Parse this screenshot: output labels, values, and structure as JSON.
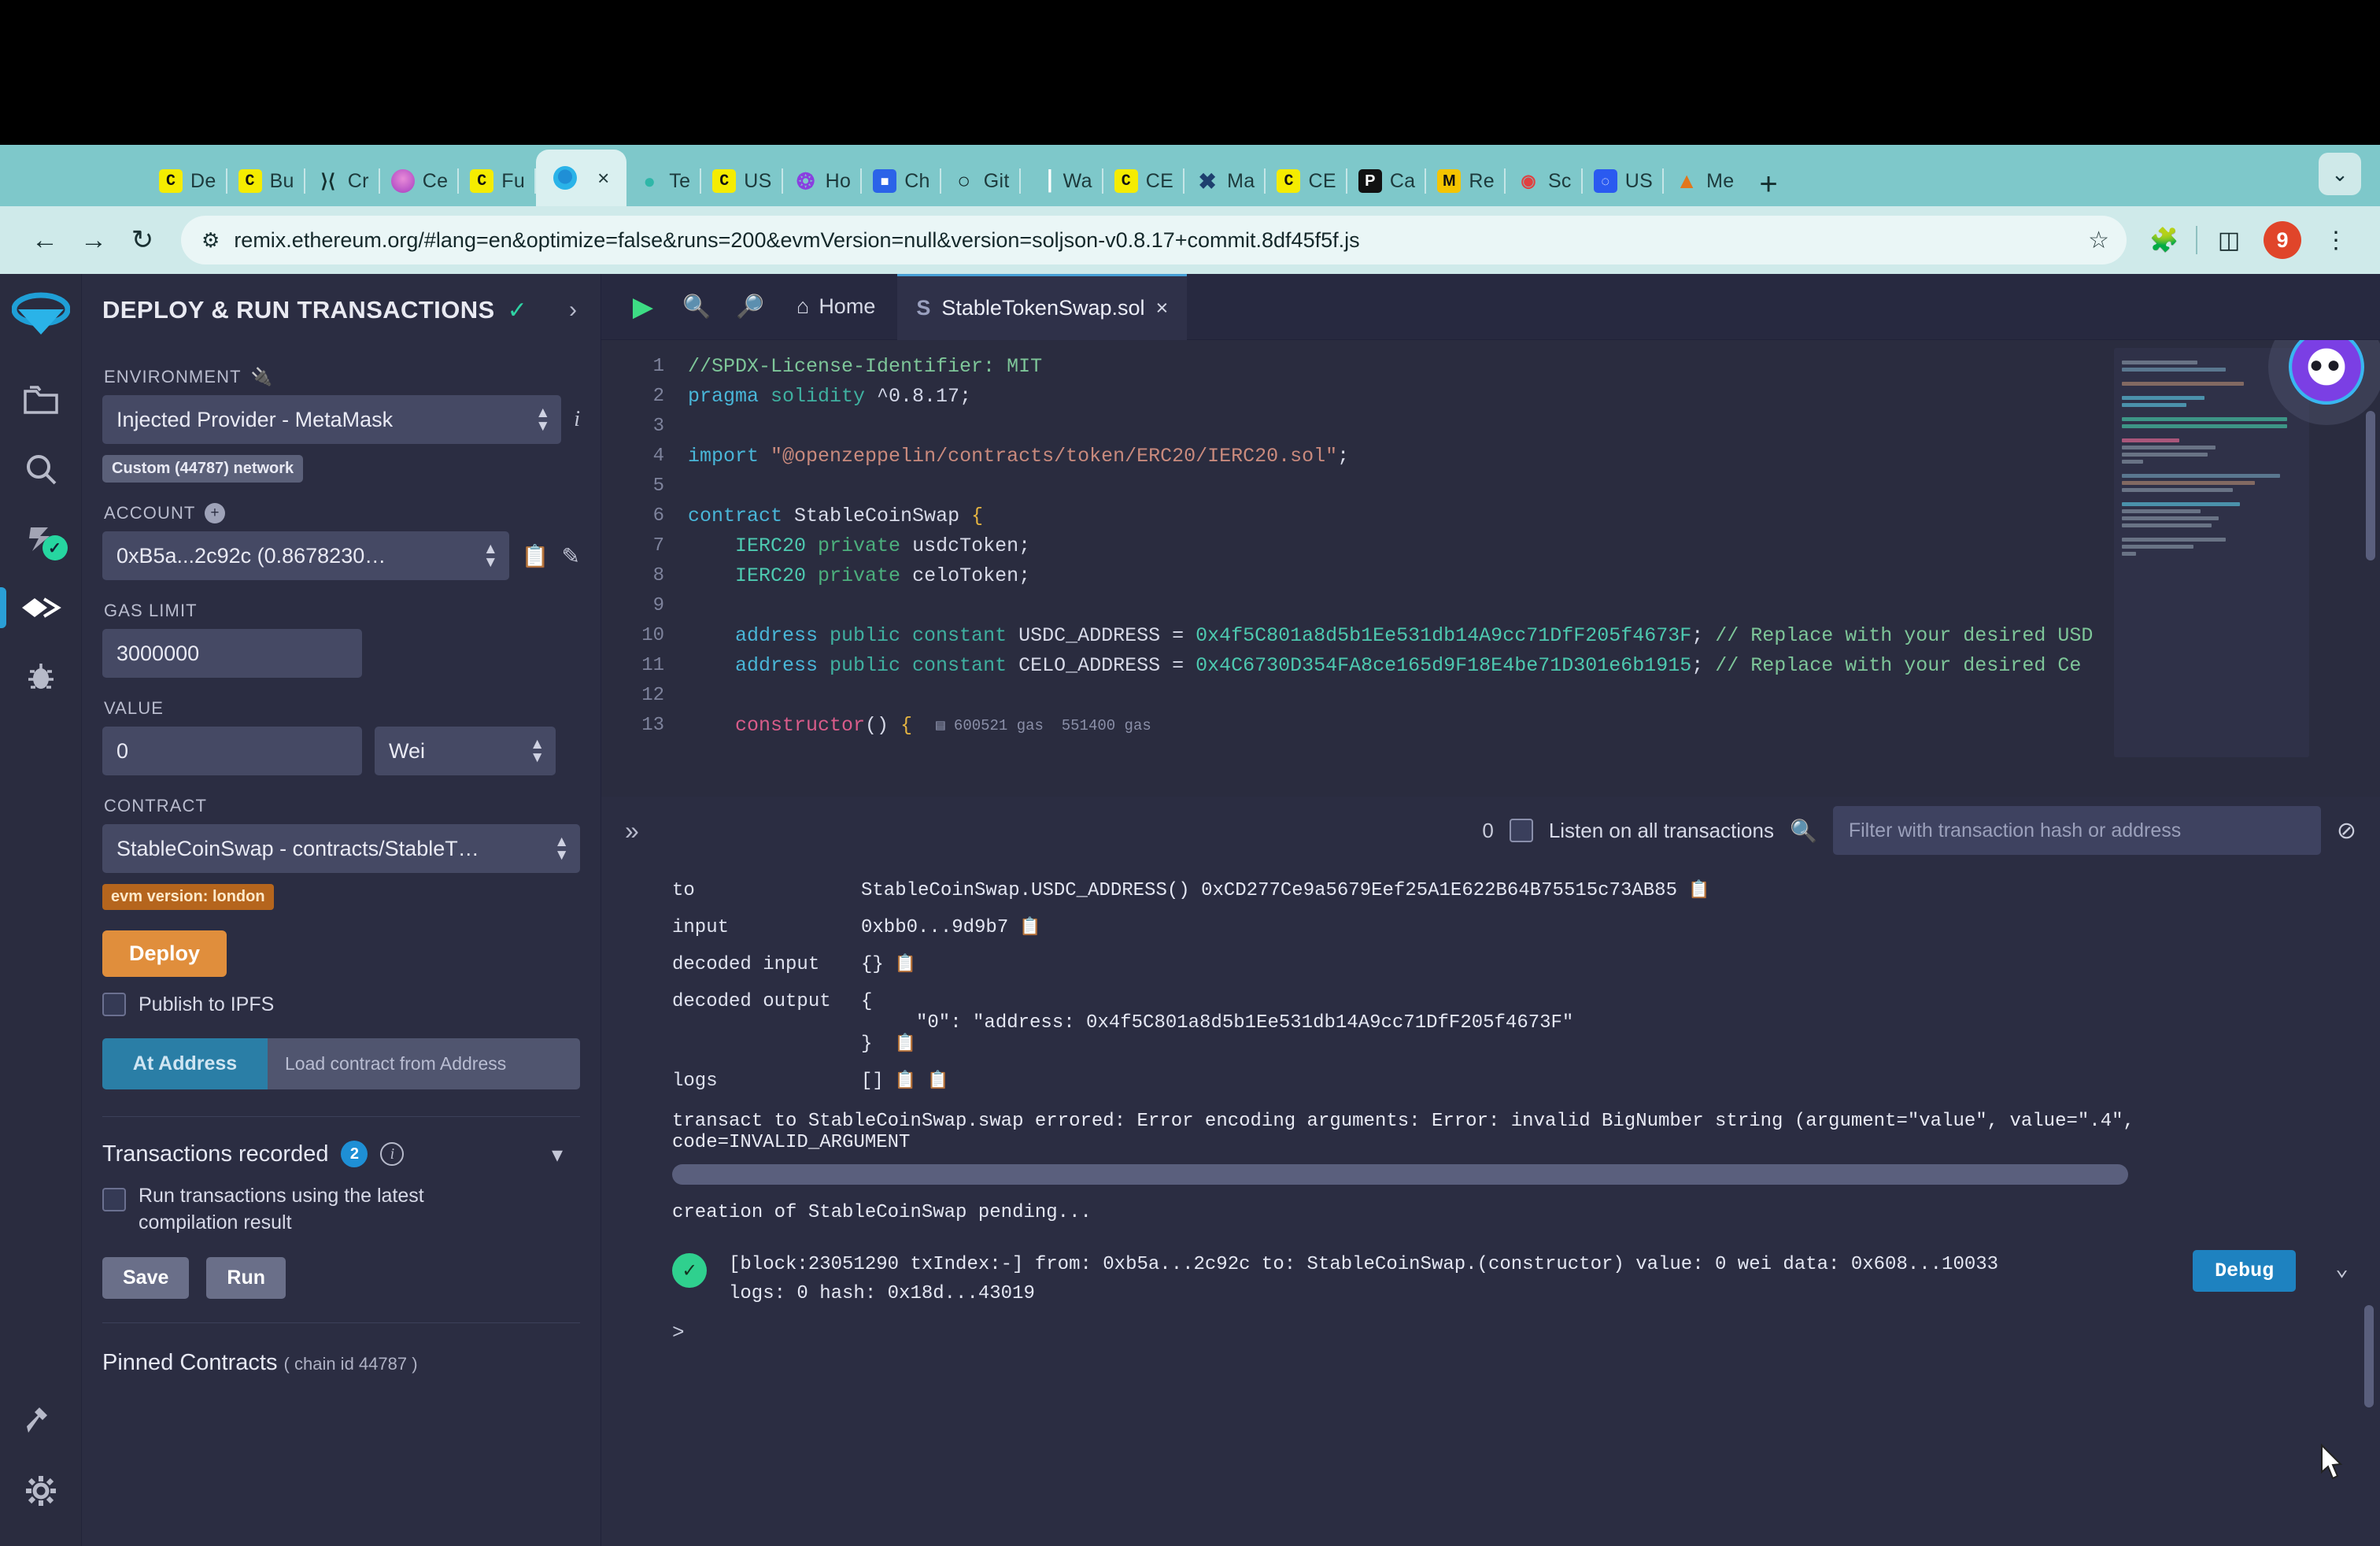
{
  "browser": {
    "tabs": [
      {
        "label": "De",
        "icon": "c-yellow-favicon"
      },
      {
        "label": "Bu",
        "icon": "c-yellow-favicon"
      },
      {
        "label": "Cr",
        "icon": "bracket-favicon"
      },
      {
        "label": "Ce",
        "icon": "celo-favicon"
      },
      {
        "label": "Fu",
        "icon": "c-yellow-favicon"
      },
      {
        "label": "",
        "icon": "remix-favicon",
        "active": true,
        "close": "×"
      },
      {
        "label": "Te",
        "icon": "teal-favicon"
      },
      {
        "label": "US",
        "icon": "c-yellow-favicon"
      },
      {
        "label": "Ho",
        "icon": "sun-favicon"
      },
      {
        "label": "Ch",
        "icon": "blue-doc-favicon"
      },
      {
        "label": "Git",
        "icon": "github-favicon"
      },
      {
        "label": "Wa",
        "icon": "chart-favicon"
      },
      {
        "label": "CE",
        "icon": "c-yellow-favicon"
      },
      {
        "label": "Ma",
        "icon": "x-blue-favicon"
      },
      {
        "label": "CE",
        "icon": "c-yellow-favicon"
      },
      {
        "label": "Ca",
        "icon": "p-black-favicon"
      },
      {
        "label": "Re",
        "icon": "m-yellow-favicon"
      },
      {
        "label": "Sc",
        "icon": "scan-favicon"
      },
      {
        "label": "US",
        "icon": "cmc-favicon"
      },
      {
        "label": "Me",
        "icon": "metamask-fox-favicon"
      }
    ],
    "new_tab": "+",
    "tab_list_chevron": "⌄",
    "back": "←",
    "forward": "→",
    "reload": "↻",
    "url": "remix.ethereum.org/#lang=en&optimize=false&runs=200&evmVersion=null&version=soljson-v0.8.17+commit.8df45f5f.js",
    "bookmark_star": "☆",
    "extensions_icon": "puzzle-icon",
    "sidepanel_icon": "side-panel-icon",
    "profile_badge": "9",
    "menu": "⋮"
  },
  "rail": {
    "items": [
      {
        "name": "remix-logo"
      },
      {
        "name": "file-explorer"
      },
      {
        "name": "search"
      },
      {
        "name": "solidity-compiler",
        "badge": "✓"
      },
      {
        "name": "deploy-run-transactions",
        "active": true
      },
      {
        "name": "debugger"
      }
    ],
    "bottom": [
      {
        "name": "plugin-manager"
      },
      {
        "name": "settings"
      }
    ]
  },
  "sidepanel": {
    "title": "DEPLOY & RUN TRANSACTIONS",
    "check": "✓",
    "chevron": "›",
    "environment_label": "ENVIRONMENT",
    "environment_value": "Injected Provider - MetaMask",
    "environment_info": "i",
    "network_badge": "Custom (44787) network",
    "account_label": "ACCOUNT",
    "account_plus": "+",
    "account_value": "0xB5a...2c92c (0.8678230…",
    "gas_limit_label": "GAS LIMIT",
    "gas_limit_value": "3000000",
    "value_label": "VALUE",
    "value_value": "0",
    "value_unit": "Wei",
    "contract_label": "CONTRACT",
    "contract_value": "StableCoinSwap - contracts/StableT…",
    "evm_badge": "evm version: london",
    "deploy_button": "Deploy",
    "publish_ipfs": "Publish to IPFS",
    "at_address_button": "At Address",
    "at_address_placeholder": "Load contract from Address",
    "transactions_recorded": "Transactions recorded",
    "transactions_count": "2",
    "run_latest_label": "Run transactions using the latest compilation result",
    "save_button": "Save",
    "run_button": "Run",
    "pinned_contracts": "Pinned Contracts",
    "pinned_sub": "( chain id 44787 )"
  },
  "editor": {
    "run_icon": "play-icon",
    "zoom_out_icon": "zoom-out-icon",
    "zoom_in_icon": "zoom-in-icon",
    "home_label": "Home",
    "tab_name": "StableTokenSwap.sol",
    "tab_close": "×",
    "lines": [
      {
        "n": "1",
        "segments": [
          {
            "t": "//SPDX-License-Identifier: MIT",
            "c": "c-com"
          }
        ]
      },
      {
        "n": "2",
        "segments": [
          {
            "t": "pragma",
            "c": "c-key"
          },
          {
            "t": " solidity ",
            "c": "c-key2"
          },
          {
            "t": "^0.8.17",
            "c": "c-num"
          },
          {
            "t": ";",
            "c": "c-id"
          }
        ]
      },
      {
        "n": "3",
        "segments": []
      },
      {
        "n": "4",
        "segments": [
          {
            "t": "import",
            "c": "c-key"
          },
          {
            "t": " ",
            "c": "c-id"
          },
          {
            "t": "\"@openzeppelin/contracts/token/ERC20/IERC20.sol\"",
            "c": "c-str"
          },
          {
            "t": ";",
            "c": "c-id"
          }
        ]
      },
      {
        "n": "5",
        "segments": []
      },
      {
        "n": "6",
        "segments": [
          {
            "t": "contract",
            "c": "c-key"
          },
          {
            "t": " StableCoinSwap ",
            "c": "c-id"
          },
          {
            "t": "{",
            "c": "c-brace"
          }
        ]
      },
      {
        "n": "7",
        "segments": [
          {
            "t": "    IERC20 ",
            "c": "c-type"
          },
          {
            "t": "private",
            "c": "c-mod"
          },
          {
            "t": " usdcToken;",
            "c": "c-id"
          }
        ]
      },
      {
        "n": "8",
        "segments": [
          {
            "t": "    IERC20 ",
            "c": "c-type"
          },
          {
            "t": "private",
            "c": "c-mod"
          },
          {
            "t": " celoToken;",
            "c": "c-id"
          }
        ]
      },
      {
        "n": "9",
        "segments": []
      },
      {
        "n": "10",
        "segments": [
          {
            "t": "    address ",
            "c": "c-key"
          },
          {
            "t": "public constant",
            "c": "c-key2"
          },
          {
            "t": " USDC_ADDRESS = ",
            "c": "c-id"
          },
          {
            "t": "0x4f5C801a8d5b1Ee531db14A9cc71DfF205f4673F",
            "c": "c-addr"
          },
          {
            "t": "; ",
            "c": "c-id"
          },
          {
            "t": "// Replace with your desired USD",
            "c": "c-com"
          }
        ]
      },
      {
        "n": "11",
        "segments": [
          {
            "t": "    address ",
            "c": "c-key"
          },
          {
            "t": "public constant",
            "c": "c-key2"
          },
          {
            "t": " CELO_ADDRESS = ",
            "c": "c-id"
          },
          {
            "t": "0x4C6730D354FA8ce165d9F18E4be71D301e6b1915",
            "c": "c-addr"
          },
          {
            "t": "; ",
            "c": "c-id"
          },
          {
            "t": "// Replace with your desired Ce",
            "c": "c-com"
          }
        ]
      },
      {
        "n": "12",
        "segments": []
      },
      {
        "n": "13",
        "segments": [
          {
            "t": "    constructor",
            "c": "c-fn"
          },
          {
            "t": "() ",
            "c": "c-id"
          },
          {
            "t": "{",
            "c": "c-brace"
          }
        ],
        "gas": "600521 gas  551400 gas"
      }
    ]
  },
  "terminal": {
    "collapse_icon": "»",
    "counter": "0",
    "listen_label": "Listen on all transactions",
    "search_icon": "search-icon",
    "filter_placeholder": "Filter with transaction hash or address",
    "clear_icon": "ban-icon",
    "rows": [
      {
        "key": "to",
        "value": "StableCoinSwap.USDC_ADDRESS() 0xCD277Ce9a5679Eef25A1E622B64B75515c73AB85",
        "copy": true
      },
      {
        "key": "input",
        "value": "0xbb0...9d9b7",
        "copy": true
      },
      {
        "key": "decoded input",
        "value": "{}",
        "copy": true
      }
    ],
    "decoded_output_key": "decoded output",
    "decoded_output_open": "{",
    "decoded_output_body": "\"0\": \"address: 0x4f5C801a8d5b1Ee531db14A9cc71DfF205f4673F\"",
    "decoded_output_close": "}",
    "logs_key": "logs",
    "logs_value": "[]",
    "error_text": "transact to StableCoinSwap.swap errored: Error encoding arguments: Error: invalid BigNumber string (argument=\"value\", value=\".4\", code=INVALID_ARGUMENT",
    "pending_text": "creation of StableCoinSwap pending...",
    "tx_status": "✓",
    "tx_line1": "[block:23051290 txIndex:-] from: 0xb5a...2c92c to: StableCoinSwap.(constructor) value: 0 wei data: 0x608...10033",
    "tx_line2": "logs: 0 hash: 0x18d...43019",
    "debug_button": "Debug",
    "tx_chevron": "⌄",
    "prompt": ">"
  }
}
